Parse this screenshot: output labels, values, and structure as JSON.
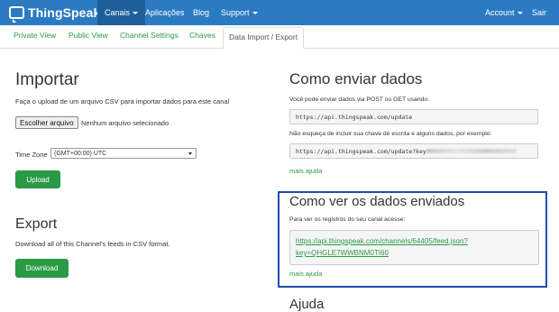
{
  "navbar": {
    "brand": "ThingSpeak",
    "items": [
      {
        "label": "Canais"
      },
      {
        "label": "Aplicações"
      },
      {
        "label": "Blog"
      },
      {
        "label": "Support"
      }
    ],
    "right": [
      {
        "label": "Account"
      },
      {
        "label": "Sair"
      }
    ],
    "color": "#2b7bc2"
  },
  "tabs": [
    {
      "label": "Private View"
    },
    {
      "label": "Public View"
    },
    {
      "label": "Channel Settings"
    },
    {
      "label": "Chaves"
    },
    {
      "label": "Data Import / Export"
    }
  ],
  "importar": {
    "title": "Importar",
    "desc": "Faça o upload de um arquivo CSV para importar dados para este canal",
    "file_button": "Escolher arquivo",
    "file_status": "Nenhum arquivo selecionado",
    "timezone_label": "Time Zone",
    "timezone_value": "(GMT+00:00) UTC",
    "upload_button": "Upload"
  },
  "export": {
    "title": "Export",
    "desc": "Download all of this Channel's feeds in CSV format.",
    "download_button": "Download"
  },
  "enviar": {
    "title": "Como enviar dados",
    "desc1": "Você pode enviar dados via POST ou GET usando:",
    "url1": "https://api.thingspeak.com/update",
    "desc2": "Não esqueça de incluir sua chave de escrita e alguns dados, por exemplo:",
    "url2_prefix": "https://api.thingspeak.com/update?key",
    "more": "mais ajuda"
  },
  "ver": {
    "title": "Como ver os dados enviados",
    "desc": "Para ver os registros do seu canal acesse:",
    "url_line1": "https://api.thingspeak.com/channels/64405/feed.json?",
    "url_line2": "key=QHGLE7WWBNM0TI60",
    "more": "mais ajuda"
  },
  "ajuda": {
    "title": "Ajuda"
  }
}
